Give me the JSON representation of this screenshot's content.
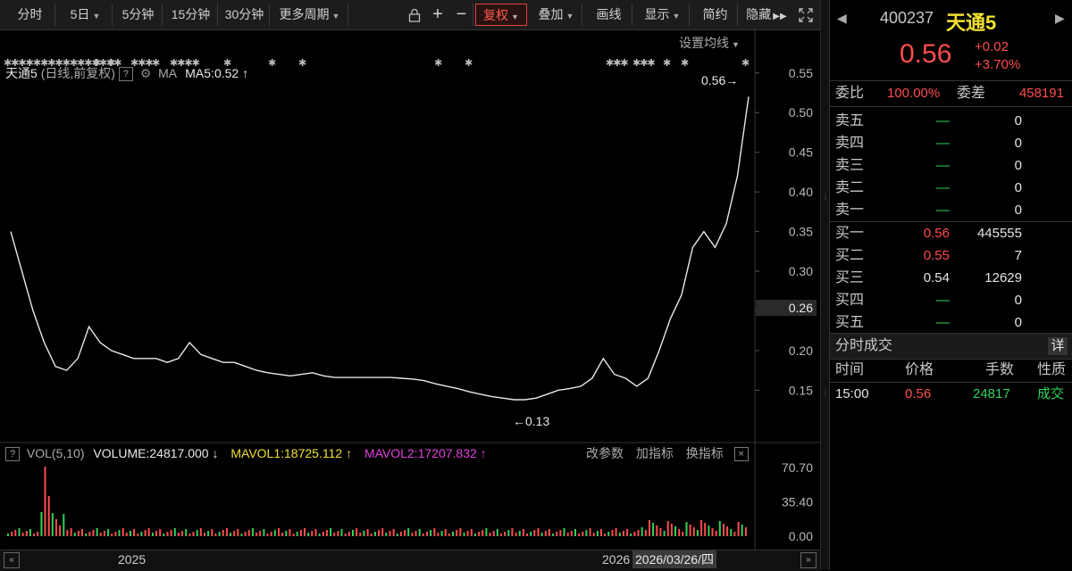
{
  "toolbar": {
    "period_buttons": [
      "分时",
      "5日",
      "5分钟",
      "15分钟",
      "30分钟",
      "更多周期"
    ],
    "fuquan": "复权",
    "diejia": "叠加",
    "huaxian": "画线",
    "xianshi": "显示",
    "jianyue": "简约",
    "yincang": "隐藏",
    "plus": "+",
    "minus": "−"
  },
  "chart_info": {
    "name": "天通5",
    "mode": "(日线,前复权)",
    "help": "?",
    "ma_label": "MA",
    "ma5": "MA5:0.52",
    "ma5_arrow": "↑",
    "setting": "设置均线",
    "latest_label": "0.56→",
    "low_label": "←0.13",
    "price_badge": "0.26"
  },
  "volume_info": {
    "help": "?",
    "label": "VOL(5,10)",
    "volume": "VOLUME:24817.000",
    "volume_arrow": "↓",
    "mavol1": "MAVOL1:18725.112",
    "mavol1_arrow": "↑",
    "mavol2": "MAVOL2:17207.832",
    "mavol2_arrow": "↑",
    "change_params": "改参数",
    "add_indicator": "加指标",
    "switch_indicator": "换指标",
    "close": "×"
  },
  "timeline": {
    "year1": "2025",
    "year2": "2026",
    "cursor_date": "2026/03/26/四"
  },
  "quote": {
    "code": "400237",
    "name": "天通5",
    "price": "0.56",
    "change": "+0.02",
    "change_pct": "+3.70%",
    "weibi_label": "委比",
    "weibi": "100.00%",
    "weicha_label": "委差",
    "weicha": "458191",
    "asks": [
      {
        "label": "卖五",
        "price": "—",
        "qty": "0"
      },
      {
        "label": "卖四",
        "price": "—",
        "qty": "0"
      },
      {
        "label": "卖三",
        "price": "—",
        "qty": "0"
      },
      {
        "label": "卖二",
        "price": "—",
        "qty": "0"
      },
      {
        "label": "卖一",
        "price": "—",
        "qty": "0"
      }
    ],
    "bids": [
      {
        "label": "买一",
        "price": "0.56",
        "qty": "445555",
        "color": "red"
      },
      {
        "label": "买二",
        "price": "0.55",
        "qty": "7",
        "color": "red"
      },
      {
        "label": "买三",
        "price": "0.54",
        "qty": "12629",
        "color": "white"
      },
      {
        "label": "买四",
        "price": "—",
        "qty": "0",
        "color": "green"
      },
      {
        "label": "买五",
        "price": "—",
        "qty": "0",
        "color": "green"
      }
    ],
    "ticks_title": "分时成交",
    "ticks_detail": "详",
    "ticks_headers": [
      "时间",
      "价格",
      "手数",
      "性质"
    ],
    "ticks": [
      {
        "time": "15:00",
        "price": "0.56",
        "volume": "24817",
        "type": "成交"
      }
    ]
  },
  "chart_data": {
    "type": "line",
    "title": "天通5 (日线,前复权)",
    "y_axis_ticks": [
      "0.55",
      "0.50",
      "0.45",
      "0.40",
      "0.35",
      "0.30",
      "0.25",
      "0.20",
      "0.15"
    ],
    "ylim": [
      0.12,
      0.57
    ],
    "volume_axis_ticks": [
      "70.70",
      "35.40",
      "0.00"
    ],
    "x_ticks": [
      "2025",
      "2026"
    ],
    "series": [
      {
        "name": "MA5",
        "values": [
          0.35,
          0.3,
          0.25,
          0.21,
          0.18,
          0.175,
          0.19,
          0.23,
          0.21,
          0.2,
          0.195,
          0.19,
          0.19,
          0.19,
          0.185,
          0.19,
          0.21,
          0.195,
          0.19,
          0.185,
          0.185,
          0.18,
          0.175,
          0.172,
          0.17,
          0.168,
          0.17,
          0.172,
          0.168,
          0.166,
          0.166,
          0.166,
          0.166,
          0.166,
          0.166,
          0.165,
          0.164,
          0.162,
          0.158,
          0.155,
          0.152,
          0.148,
          0.145,
          0.142,
          0.14,
          0.138,
          0.138,
          0.14,
          0.145,
          0.15,
          0.152,
          0.155,
          0.165,
          0.19,
          0.17,
          0.165,
          0.155,
          0.165,
          0.2,
          0.24,
          0.27,
          0.33,
          0.35,
          0.33,
          0.36,
          0.42,
          0.52
        ]
      }
    ]
  }
}
